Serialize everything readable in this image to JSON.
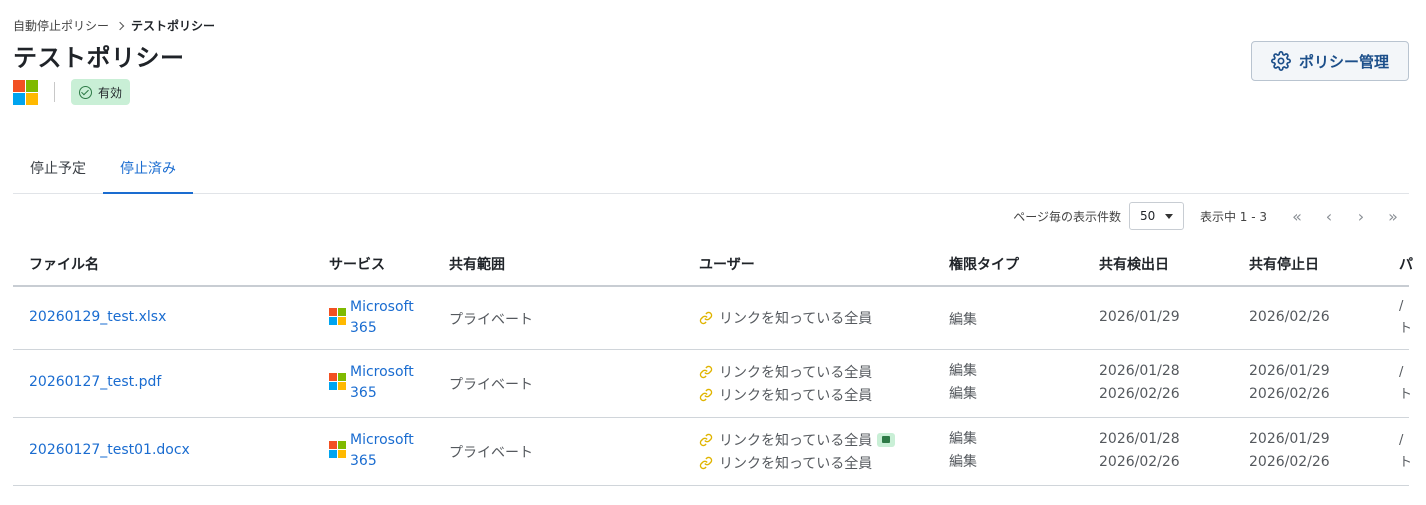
{
  "breadcrumb": {
    "parent": "自動停止ポリシー",
    "current": "テストポリシー"
  },
  "page": {
    "title": "テストポリシー",
    "status": "有効",
    "policy_button": "ポリシー管理"
  },
  "tabs": [
    {
      "label": "停止予定"
    },
    {
      "label": "停止済み",
      "active": true
    }
  ],
  "pager": {
    "per_page_label": "ページ毎の表示件数",
    "per_page_value": "50",
    "range": "表示中 1 - 3"
  },
  "table": {
    "headers": [
      "ファイル名",
      "サービス",
      "共有範囲",
      "ユーザー",
      "権限タイプ",
      "共有検出日",
      "共有停止日",
      "パ"
    ],
    "rows": [
      {
        "file": "20260129_test.xlsx",
        "service": [
          "Microsoft",
          "365"
        ],
        "scope": "プライベート",
        "users": [
          "リンクを知っている全員"
        ],
        "permissions": [
          "編集"
        ],
        "detected": [
          "2026/01/29"
        ],
        "stopped": [
          "2026/02/26"
        ],
        "path": [
          "/",
          "ト"
        ]
      },
      {
        "file": "20260127_test.pdf",
        "service": [
          "Microsoft",
          "365"
        ],
        "scope": "プライベート",
        "users": [
          "リンクを知っている全員",
          "リンクを知っている全員"
        ],
        "permissions": [
          "編集",
          "編集"
        ],
        "detected": [
          "2026/01/28",
          "2026/02/26"
        ],
        "stopped": [
          "2026/01/29",
          "2026/02/26"
        ],
        "path": [
          "/",
          "ト"
        ]
      },
      {
        "file": "20260127_test01.docx",
        "service": [
          "Microsoft",
          "365"
        ],
        "scope": "プライベート",
        "users": [
          "リンクを知っている全員",
          "リンクを知っている全員"
        ],
        "permissions": [
          "編集",
          "編集"
        ],
        "detected": [
          "2026/01/28",
          "2026/02/26"
        ],
        "stopped": [
          "2026/01/29",
          "2026/02/26"
        ],
        "path": [
          "/",
          "ト"
        ]
      }
    ]
  },
  "colors": {
    "link": "#1a6cd0",
    "badge_bg": "#c9efd6",
    "link_icon": "#e0b400"
  },
  "icons": [
    "chevron-right-icon",
    "microsoft-logo",
    "check-circle-icon",
    "gear-icon",
    "caret-down-icon",
    "first-page-icon",
    "prev-page-icon",
    "next-page-icon",
    "last-page-icon",
    "link-icon",
    "calendar-icon"
  ]
}
